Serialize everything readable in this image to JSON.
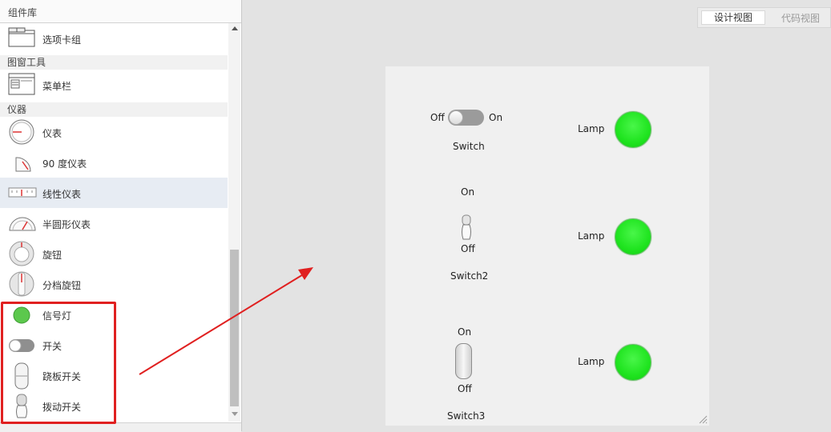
{
  "panel": {
    "title": "组件库",
    "categories": [
      "图窗工具",
      "仪器"
    ],
    "items": [
      {
        "label": "选项卡组",
        "icon": "tab-group-icon"
      },
      {
        "label": "菜单栏",
        "icon": "menu-bar-icon"
      },
      {
        "label": "仪表",
        "icon": "gauge-icon"
      },
      {
        "label": "90 度仪表",
        "icon": "ninety-degree-gauge-icon"
      },
      {
        "label": "线性仪表",
        "icon": "linear-gauge-icon"
      },
      {
        "label": "半圆形仪表",
        "icon": "semicircular-gauge-icon"
      },
      {
        "label": "旋钮",
        "icon": "knob-icon"
      },
      {
        "label": "分档旋钮",
        "icon": "discrete-knob-icon"
      },
      {
        "label": "信号灯",
        "icon": "lamp-icon"
      },
      {
        "label": "开关",
        "icon": "switch-icon"
      },
      {
        "label": "跷板开关",
        "icon": "rocker-switch-icon"
      },
      {
        "label": "拨动开关",
        "icon": "toggle-switch-icon"
      }
    ],
    "selected_item": "线性仪表"
  },
  "tabs": {
    "design": "设计视图",
    "code": "代码视图",
    "active": "设计视图"
  },
  "canvas": {
    "switch1": {
      "off_label": "Off",
      "on_label": "On",
      "name": "Switch"
    },
    "switch2": {
      "on_label": "On",
      "off_label": "Off",
      "name": "Switch2"
    },
    "switch3": {
      "on_label": "On",
      "off_label": "Off",
      "name": "Switch3"
    },
    "lamps": [
      {
        "label": "Lamp",
        "color": "#22e622"
      },
      {
        "label": "Lamp",
        "color": "#22e622"
      },
      {
        "label": "Lamp",
        "color": "#22e622"
      }
    ]
  },
  "annotation": {
    "box_color": "#e02020",
    "arrow_color": "#e02020"
  }
}
